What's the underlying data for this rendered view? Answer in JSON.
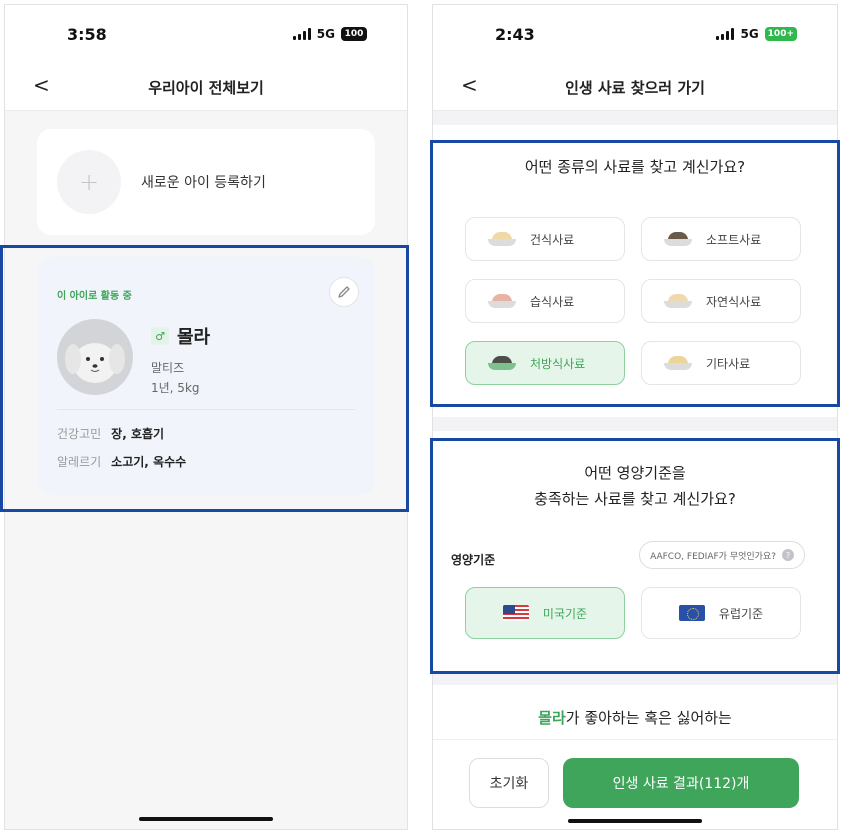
{
  "left": {
    "status": {
      "time": "3:58",
      "network": "5G",
      "battery": "100"
    },
    "nav": {
      "back": "<",
      "title": "우리아이 전체보기"
    },
    "register": {
      "plus": "+",
      "label": "새로운 아이 등록하기"
    },
    "pet": {
      "active_label": "이 아이로 활동 중",
      "gender": "♂",
      "name": "몰라",
      "breed": "말티즈",
      "age_weight": "1년, 5kg",
      "health_label": "건강고민",
      "health_value": "장, 호흡기",
      "allergy_label": "알레르기",
      "allergy_value": "소고기, 옥수수"
    }
  },
  "right": {
    "status": {
      "time": "2:43",
      "network": "5G",
      "battery": "100+"
    },
    "nav": {
      "back": "<",
      "title": "인생 사료 찾으러 가기"
    },
    "food_type": {
      "question": "어떤 종류의 사료를 찾고 계신가요?",
      "options": [
        {
          "label": "건식사료",
          "food_color": "#efd9a6",
          "dish_color": "#dcdcdc",
          "selected": false
        },
        {
          "label": "소프트사료",
          "food_color": "#6b5a4a",
          "dish_color": "#dcdcdc",
          "selected": false
        },
        {
          "label": "습식사료",
          "food_color": "#e9b3a3",
          "dish_color": "#dcdcdc",
          "selected": false
        },
        {
          "label": "자연식사료",
          "food_color": "#f0d9ac",
          "dish_color": "#dcdcdc",
          "selected": false
        },
        {
          "label": "처방식사료",
          "food_color": "#4b4f48",
          "dish_color": "#7fc08f",
          "selected": true
        },
        {
          "label": "기타사료",
          "food_color": "#ebd59b",
          "dish_color": "#dcdcdc",
          "selected": false
        }
      ]
    },
    "nutrition": {
      "question_line1": "어떤 영양기준을",
      "question_line2": "충족하는 사료를 찾고 계신가요?",
      "label": "영양기준",
      "help_text": "AAFCO, FEDIAF가 무엇인가요?",
      "help_icon": "?",
      "options": [
        {
          "label": "미국기준",
          "flag": "us-flag-icon",
          "selected": true
        },
        {
          "label": "유럽기준",
          "flag": "eu-flag-icon",
          "selected": false
        }
      ]
    },
    "preference": {
      "name": "몰라",
      "rest": "가 좋아하는 혹은 싫어하는"
    },
    "bottom": {
      "reset": "초기화",
      "result": "인생 사료 결과(112)개"
    }
  },
  "colors": {
    "accent": "#3fa55b",
    "highlight_border": "#1748a3"
  }
}
